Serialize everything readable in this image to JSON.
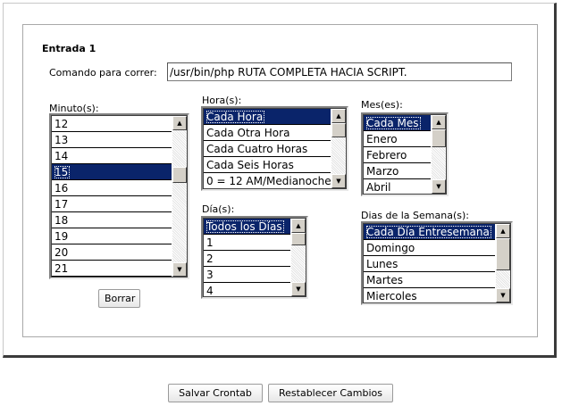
{
  "entry": {
    "title": "Entrada 1",
    "command_label": "Comando para correr:",
    "command_value": "/usr/bin/php RUTA COMPLETA HACIA SCRIPT."
  },
  "minuto": {
    "label": "Minuto(s):",
    "items": [
      "12",
      "13",
      "14",
      "15",
      "16",
      "17",
      "18",
      "19",
      "20",
      "21"
    ],
    "selected": "15"
  },
  "hora": {
    "label": "Hora(s):",
    "items": [
      "Cada Hora",
      "Cada Otra Hora",
      "Cada Cuatro Horas",
      "Cada Seis Horas",
      "0 = 12 AM/Medianoche"
    ],
    "selected": "Cada Hora"
  },
  "mes": {
    "label": "Mes(es):",
    "items": [
      "Cada Mes",
      "Enero",
      "Febrero",
      "Marzo",
      "Abril"
    ],
    "selected": "Cada Mes"
  },
  "dia": {
    "label": "Día(s):",
    "items": [
      "Todos los Días",
      "1",
      "2",
      "3",
      "4"
    ],
    "selected": "Todos los Días"
  },
  "semana": {
    "label": "Dias de la Semana(s):",
    "items": [
      "Cada Día Entresemana",
      "Domingo",
      "Lunes",
      "Martes",
      "Miercoles"
    ],
    "selected": "Cada Día Entresemana"
  },
  "buttons": {
    "borrar": "Borrar",
    "salvar": "Salvar Crontab",
    "restablecer": "Restablecer Cambios"
  },
  "icons": {
    "scroll_up": "scroll-up-arrow-icon",
    "scroll_down": "scroll-down-arrow-icon"
  },
  "colors": {
    "selection": "#0a246a"
  }
}
